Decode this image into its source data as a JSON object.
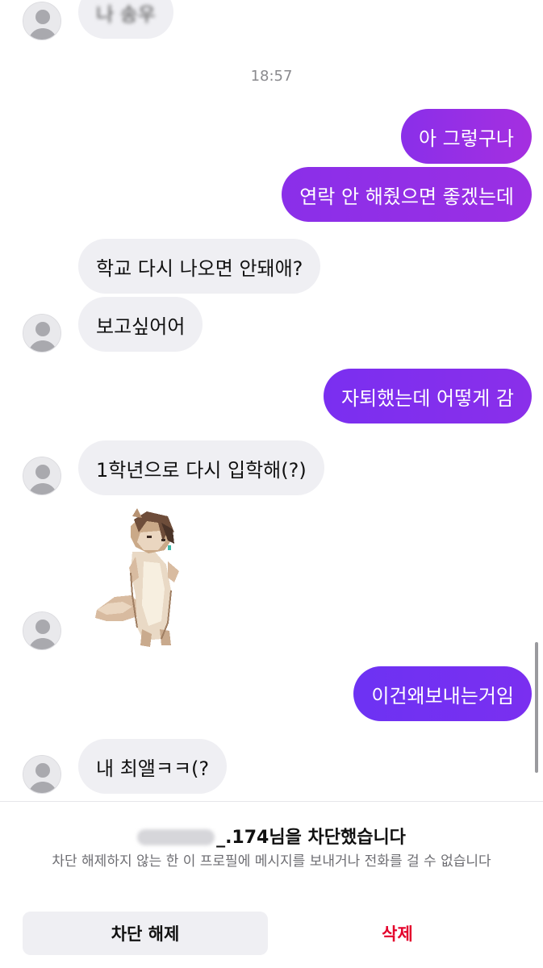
{
  "conversation": {
    "top_partial_message": "나 송우",
    "timestamp": "18:57",
    "messages": [
      {
        "direction": "out",
        "text": "아 그렇구나"
      },
      {
        "direction": "out",
        "text": "연락 안 해줬으면 좋겠는데"
      },
      {
        "direction": "in",
        "text": "학교 다시 나오면 안돼애?"
      },
      {
        "direction": "in",
        "text": "보고싶어어"
      },
      {
        "direction": "out",
        "text": "자퇴했는데 어떻게 감"
      },
      {
        "direction": "in",
        "text": "1학년으로 다시 입학해(?)"
      },
      {
        "direction": "in",
        "type": "sticker",
        "icon": "pixel-animal-sticker"
      },
      {
        "direction": "out",
        "text": "이건왜보내는거임"
      },
      {
        "direction": "in",
        "text": "내 최앨ㅋㅋ(?"
      }
    ]
  },
  "colors": {
    "outgoing_gradient_start": "#7a2ff0",
    "outgoing_gradient_end": "#a02fe0",
    "incoming_bubble": "#efeff3",
    "delete_red": "#e4002b"
  },
  "block_panel": {
    "title_suffix": "_.174님을 차단했습니다",
    "description": "차단 해제하지 않는 한 이 프로필에 메시지를 보내거나 전화를 걸 수 없습니다",
    "unblock_label": "차단 해제",
    "delete_label": "삭제"
  }
}
